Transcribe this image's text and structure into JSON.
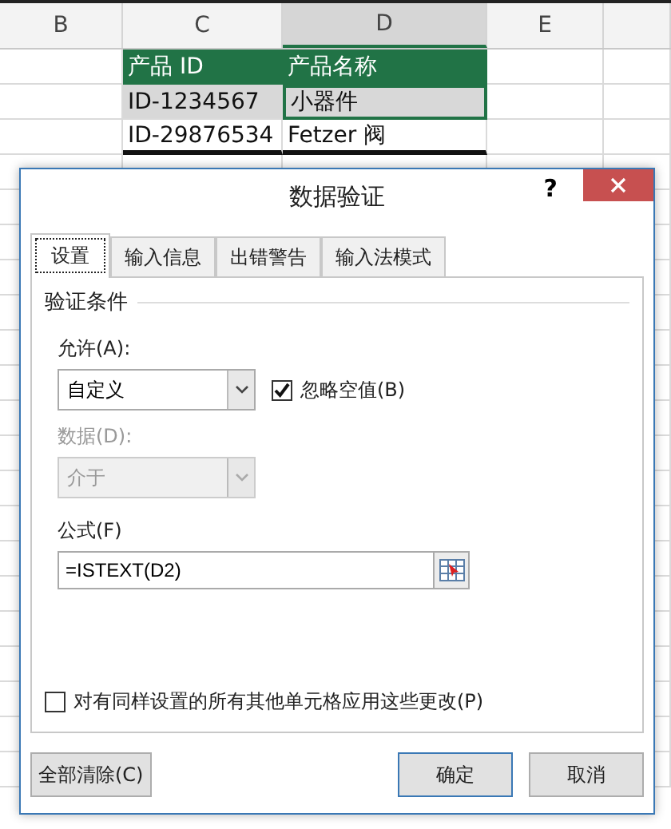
{
  "sheet": {
    "columns": [
      {
        "label": "B",
        "selected": false
      },
      {
        "label": "C",
        "selected": false
      },
      {
        "label": "D",
        "selected": true
      },
      {
        "label": "E",
        "selected": false
      }
    ],
    "table": {
      "columns": [
        "产品 ID",
        "产品名称"
      ],
      "rows": [
        {
          "cells": [
            "ID-1234567",
            "小器件"
          ],
          "selected": true
        },
        {
          "cells": [
            "ID-29876534",
            "Fetzer 阀"
          ],
          "selected": false
        }
      ]
    }
  },
  "dialog": {
    "title": "数据验证",
    "help": "?",
    "tabs": [
      {
        "label": "设置",
        "selected": true
      },
      {
        "label": "输入信息",
        "selected": false
      },
      {
        "label": "出错警告",
        "selected": false
      },
      {
        "label": "输入法模式",
        "selected": false
      }
    ],
    "group": "验证条件",
    "allow": {
      "label": "允许(A):",
      "value": "自定义",
      "disabled": false
    },
    "ignore_blank": {
      "label": "忽略空值(B)",
      "checked": true
    },
    "data": {
      "label": "数据(D):",
      "value": "介于",
      "disabled": true
    },
    "formula": {
      "label": "公式(F)",
      "value": "=ISTEXT(D2)"
    },
    "apply_all": {
      "label": "对有同样设置的所有其他单元格应用这些更改(P)",
      "checked": false
    },
    "buttons": [
      "全部清除(C)",
      "确定",
      "取消"
    ]
  }
}
